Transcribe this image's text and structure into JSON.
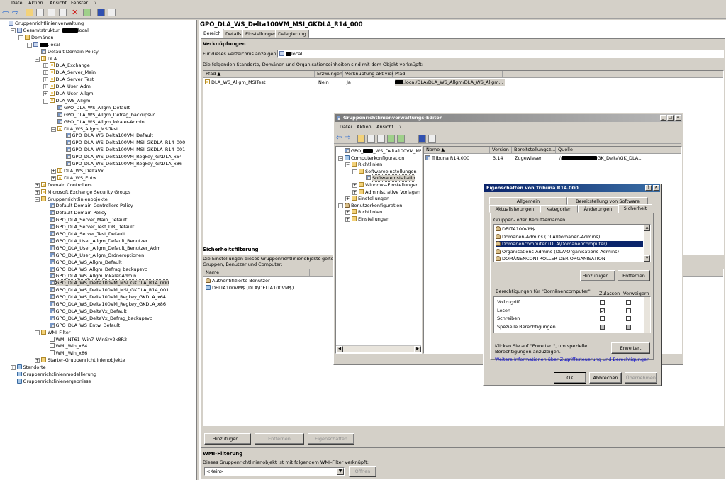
{
  "menu": [
    "Datei",
    "Aktion",
    "Ansicht",
    "Fenster",
    "?"
  ],
  "tree": [
    {
      "t": "Gruppenrichtlinienverwaltung",
      "l": 0,
      "pm": "",
      "i": "i-dom"
    },
    {
      "t": "Gesamtstruktur: ",
      "r": 22,
      "s": "local",
      "l": 1,
      "pm": "−",
      "i": "i-dom"
    },
    {
      "t": "Domänen",
      "l": 2,
      "pm": "−",
      "i": "i-fold"
    },
    {
      "t": "",
      "r": 12,
      "s": ".local",
      "l": 3,
      "pm": "−",
      "i": "i-dom"
    },
    {
      "t": "Default Domain Policy",
      "l": 4,
      "pm": "",
      "i": "i-gpo"
    },
    {
      "t": "DLA",
      "l": 4,
      "pm": "−",
      "i": "i-ou"
    },
    {
      "t": "DLA_Exchange",
      "l": 5,
      "pm": "+",
      "i": "i-ou"
    },
    {
      "t": "DLA_Server_Main",
      "l": 5,
      "pm": "+",
      "i": "i-ou"
    },
    {
      "t": "DLA_Server_Test",
      "l": 5,
      "pm": "+",
      "i": "i-ou"
    },
    {
      "t": "DLA_User_Adm",
      "l": 5,
      "pm": "+",
      "i": "i-ou"
    },
    {
      "t": "DLA_User_Allgm",
      "l": 5,
      "pm": "+",
      "i": "i-ou"
    },
    {
      "t": "DLA_WS_Allgm",
      "l": 5,
      "pm": "−",
      "i": "i-ou"
    },
    {
      "t": "GPO_DLA_WS_Allgm_Default",
      "l": 6,
      "pm": "",
      "i": "i-gpo"
    },
    {
      "t": "GPO_DLA_WS_Allgm_Defrag_backupsvc",
      "l": 6,
      "pm": "",
      "i": "i-gpo"
    },
    {
      "t": "GPO_DLA_WS_Allgm_lokaler-Admin",
      "l": 6,
      "pm": "",
      "i": "i-gpo"
    },
    {
      "t": "DLA_WS_Allgm_MSITest",
      "l": 6,
      "pm": "−",
      "i": "i-ou"
    },
    {
      "t": "GPO_DLA_WS_Delta100VM_Default",
      "l": 7,
      "pm": "",
      "i": "i-gpo"
    },
    {
      "t": "GPO_DLA_WS_Delta100VM_MSI_GKDLA_R14_000",
      "l": 7,
      "pm": "",
      "i": "i-gpo"
    },
    {
      "t": "GPO_DLA_WS_Delta100VM_MSI_GKDLA_R14_001",
      "l": 7,
      "pm": "",
      "i": "i-gpo"
    },
    {
      "t": "GPO_DLA_WS_Delta100VM_Regkey_GKDLA_x64",
      "l": 7,
      "pm": "",
      "i": "i-gpo"
    },
    {
      "t": "GPO_DLA_WS_Delta100VM_Regkey_GKDLA_x86",
      "l": 7,
      "pm": "",
      "i": "i-gpo"
    },
    {
      "t": "DLA_WS_DeltaVx",
      "l": 6,
      "pm": "+",
      "i": "i-ou"
    },
    {
      "t": "DLA_WS_Entw",
      "l": 6,
      "pm": "+",
      "i": "i-ou"
    },
    {
      "t": "Domain Controllers",
      "l": 4,
      "pm": "+",
      "i": "i-ou"
    },
    {
      "t": "Microsoft Exchange Security Groups",
      "l": 4,
      "pm": "+",
      "i": "i-ou"
    },
    {
      "t": "Gruppenrichtlinienobjekte",
      "l": 4,
      "pm": "−",
      "i": "i-fold"
    },
    {
      "t": "Default Domain Controllers Policy",
      "l": 5,
      "pm": "",
      "i": "i-gpo"
    },
    {
      "t": "Default Domain Policy",
      "l": 5,
      "pm": "",
      "i": "i-gpo"
    },
    {
      "t": "GPO_DLA_Server_Main_Default",
      "l": 5,
      "pm": "",
      "i": "i-gpo"
    },
    {
      "t": "GPO_DLA_Server_Test_DB_Default",
      "l": 5,
      "pm": "",
      "i": "i-gpo"
    },
    {
      "t": "GPO_DLA_Server_Test_Default",
      "l": 5,
      "pm": "",
      "i": "i-gpo"
    },
    {
      "t": "GPO_DLA_User_Allgm_Default_Benutzer",
      "l": 5,
      "pm": "",
      "i": "i-gpo"
    },
    {
      "t": "GPO_DLA_User_Allgm_Default_Benutzer_Adm",
      "l": 5,
      "pm": "",
      "i": "i-gpo"
    },
    {
      "t": "GPO_DLA_User_Allgm_Ordneroptionen",
      "l": 5,
      "pm": "",
      "i": "i-gpo"
    },
    {
      "t": "GPO_DLA_WS_Allgm_Default",
      "l": 5,
      "pm": "",
      "i": "i-gpo"
    },
    {
      "t": "GPO_DLA_WS_Allgm_Defrag_backupsvc",
      "l": 5,
      "pm": "",
      "i": "i-gpo"
    },
    {
      "t": "GPO_DLA_WS_Allgm_lokaler-Admin",
      "l": 5,
      "pm": "",
      "i": "i-gpo"
    },
    {
      "t": "GPO_DLA_WS_Delta100VM_MSI_GKDLA_R14_000",
      "l": 5,
      "pm": "",
      "i": "i-gpo",
      "sel": true
    },
    {
      "t": "GPO_DLA_WS_Delta100VM_MSI_GKDLA_R14_001",
      "l": 5,
      "pm": "",
      "i": "i-gpo"
    },
    {
      "t": "GPO_DLA_WS_Delta100VM_Regkey_GKDLA_x64",
      "l": 5,
      "pm": "",
      "i": "i-gpo"
    },
    {
      "t": "GPO_DLA_WS_Delta100VM_Regkey_GKDLA_x86",
      "l": 5,
      "pm": "",
      "i": "i-gpo"
    },
    {
      "t": "GPO_DLA_WS_DeltaVx_Default",
      "l": 5,
      "pm": "",
      "i": "i-gpo"
    },
    {
      "t": "GPO_DLA_WS_DeltaVx_Defrag_backupsvc",
      "l": 5,
      "pm": "",
      "i": "i-gpo"
    },
    {
      "t": "GPO_DLA_WS_Entw_Default",
      "l": 5,
      "pm": "",
      "i": "i-gpo"
    },
    {
      "t": "WMI-Filter",
      "l": 4,
      "pm": "−",
      "i": "i-fold"
    },
    {
      "t": "WMI_NT61_Win7_WinSrv2k8R2",
      "l": 5,
      "pm": "",
      "i": "i-wmi"
    },
    {
      "t": "WMI_Win_x64",
      "l": 5,
      "pm": "",
      "i": "i-wmi"
    },
    {
      "t": "WMI_Win_x86",
      "l": 5,
      "pm": "",
      "i": "i-wmi"
    },
    {
      "t": "Starter-Gruppenrichtlinienobjekte",
      "l": 4,
      "pm": "+",
      "i": "i-fold"
    },
    {
      "t": "Standorte",
      "l": 1,
      "pm": "+",
      "i": "i-net"
    },
    {
      "t": "Gruppenrichtlinienmodellierung",
      "l": 1,
      "pm": "",
      "i": "i-net"
    },
    {
      "t": "Gruppenrichtlinienergebnisse",
      "l": 1,
      "pm": "",
      "i": "i-net"
    }
  ],
  "right": {
    "title": "GPO_DLA_WS_Delta100VM_MSI_GKDLA_R14_000",
    "tabs": [
      "Bereich",
      "Details",
      "Einstellungen",
      "Delegierung"
    ],
    "links_heading": "Verknüpfungen",
    "dir_label": "Für dieses Verzeichnis anzeigen:",
    "dir_value": "local",
    "links_desc": "Die folgenden Standorte, Domänen und Organisationseinheiten sind mit dem Objekt verknüpft:",
    "link_cols": [
      "Pfad",
      "Erzwungen",
      "Verknüpfung aktiviert",
      "Pfad"
    ],
    "link_row": {
      "path": "DLA_WS_Allgm_MSITest",
      "enforced": "Nein",
      "enabled": "Ja",
      "full": ".local/DLA/DLA_WS_Allgm/DLA_WS_Allgm..."
    },
    "sec_heading": "Sicherheitsfilterung",
    "sec_desc1": "Die Einstellungen dieses Gruppenrichtlinienobjekts gelten nur f",
    "sec_desc2": "Gruppen, Benutzer und Computer:",
    "sec_col": "Name",
    "sec_rows": [
      "Authentifizierte Benutzer",
      "DELTA100VM$ (DLA\\DELTA100VM$)"
    ],
    "btn_add": "Hinzufügen...",
    "btn_remove": "Entfernen",
    "btn_props": "Eigenschaften",
    "wmi_heading": "WMI-Filterung",
    "wmi_desc": "Dieses Gruppenrichtlinienobjekt ist mit folgendem WMI-Filter verknüpft:",
    "wmi_value": "<Kein>",
    "btn_open": "Öffnen"
  },
  "editor": {
    "title": "Gruppenrichtlinienverwaltungs-Editor",
    "menu": [
      "Datei",
      "Aktion",
      "Ansicht",
      "?"
    ],
    "tree": [
      {
        "t": "GPO_",
        "r": 14,
        "s": "_WS_Delta100VM_MSI_G",
        "l": 0,
        "pm": "",
        "i": "i-gpo"
      },
      {
        "t": "Computerkonfiguration",
        "l": 0,
        "pm": "−",
        "i": "i-net"
      },
      {
        "t": "Richtlinien",
        "l": 1,
        "pm": "−",
        "i": "i-fold"
      },
      {
        "t": "Softwareeinstellungen",
        "l": 2,
        "pm": "−",
        "i": "i-fold"
      },
      {
        "t": "Softwareinstallatio",
        "l": 3,
        "pm": "",
        "i": "i-gpo",
        "sel": true
      },
      {
        "t": "Windows-Einstellungen",
        "l": 2,
        "pm": "+",
        "i": "i-fold"
      },
      {
        "t": "Administrative Vorlagen",
        "l": 2,
        "pm": "+",
        "i": "i-fold"
      },
      {
        "t": "Einstellungen",
        "l": 1,
        "pm": "+",
        "i": "i-fold"
      },
      {
        "t": "Benutzerkonfiguration",
        "l": 0,
        "pm": "−",
        "i": "i-usr"
      },
      {
        "t": "Richtlinien",
        "l": 1,
        "pm": "+",
        "i": "i-fold"
      },
      {
        "t": "Einstellungen",
        "l": 1,
        "pm": "+",
        "i": "i-fold"
      }
    ],
    "cols": [
      "Name",
      "Version",
      "Bereitstellungsz...",
      "Quelle"
    ],
    "row": {
      "name": "Tribuna R14.000",
      "version": "3.14",
      "deploy": "Zugewiesen",
      "source_pre": "\\\\",
      "source_post": "GK_Delta\\GK_DLA..."
    }
  },
  "props": {
    "title": "Eigenschaften von Tribuna R14.000",
    "tabs_top": [
      "Allgemein",
      "Bereitstellung von Software"
    ],
    "tabs_bottom": [
      "Aktualisierungen",
      "Kategorien",
      "Änderungen",
      "Sicherheit"
    ],
    "group_label": "Gruppen- oder Benutzernamen:",
    "principals": [
      {
        "n": "DELTA100VM$",
        "i": "i-usr"
      },
      {
        "n": "Domänen-Admins (DLA\\Domänen-Admins)",
        "i": "i-usr"
      },
      {
        "n": "Domänencomputer (DLA\\Domänencomputer)",
        "i": "i-usr",
        "sel": true
      },
      {
        "n": "Organisations-Admins (DLA\\Organisations-Admins)",
        "i": "i-usr"
      },
      {
        "n": "DOMÄNENCONTROLLER DER ORGANISATION",
        "i": "i-usr"
      }
    ],
    "btn_add": "Hinzufügen...",
    "btn_remove": "Entfernen",
    "perm_label": "Berechtigungen für \"Domänencomputer\"",
    "col_allow": "Zulassen",
    "col_deny": "Verweigern",
    "perms": [
      {
        "n": "Vollzugriff",
        "allow": "",
        "deny": ""
      },
      {
        "n": "Lesen",
        "allow": "✓",
        "deny": ""
      },
      {
        "n": "Schreiben",
        "allow": "",
        "deny": ""
      },
      {
        "n": "Spezielle Berechtigungen",
        "allow": "",
        "deny": "",
        "gray": true
      }
    ],
    "adv_text1": "Klicken Sie auf \"Erweitert\", um spezielle",
    "adv_text2": "Berechtigungen anzuzeigen.",
    "btn_adv": "Erweitert",
    "link": "Weitere Informationen über Zugriffssteuerung und Berechtigungen",
    "btn_ok": "OK",
    "btn_cancel": "Abbrechen",
    "btn_apply": "Übernehmen"
  }
}
